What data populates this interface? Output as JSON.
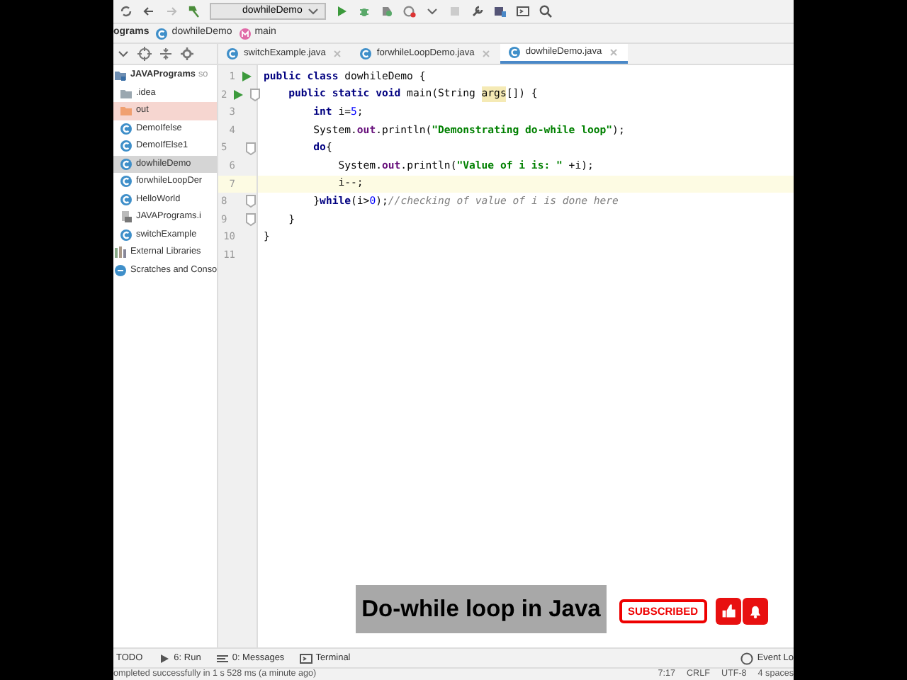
{
  "toolbar": {
    "run_config": "dowhileDemo"
  },
  "breadcrumb": [
    {
      "label": "ograms",
      "kind": "project"
    },
    {
      "label": "dowhileDemo",
      "kind": "class"
    },
    {
      "label": "main",
      "kind": "method"
    }
  ],
  "project_tree": [
    {
      "label": "JAVAPrograms",
      "suffix": "so",
      "kind": "module",
      "selected": false,
      "children": [
        {
          "label": ".idea",
          "kind": "folder",
          "selected": false
        },
        {
          "label": "out",
          "kind": "excluded",
          "selected": false
        },
        {
          "label": "DemoIfelse",
          "kind": "class",
          "selected": false
        },
        {
          "label": "DemoIfElse1",
          "kind": "class",
          "selected": false
        },
        {
          "label": "dowhileDemo",
          "kind": "class",
          "selected": true
        },
        {
          "label": "forwhileLoopDer",
          "kind": "class",
          "selected": false
        },
        {
          "label": "HelloWorld",
          "kind": "class",
          "selected": false
        },
        {
          "label": "JAVAPrograms.i",
          "kind": "file",
          "selected": false
        },
        {
          "label": "switchExample",
          "kind": "class",
          "selected": false
        }
      ]
    },
    {
      "label": "External Libraries",
      "kind": "library",
      "selected": false
    },
    {
      "label": "Scratches and Conso",
      "kind": "scratch",
      "selected": false
    }
  ],
  "editor_tabs": [
    {
      "label": "switchExample.java",
      "selected": false
    },
    {
      "label": "forwhileLoopDemo.java",
      "selected": false
    },
    {
      "label": "dowhileDemo.java",
      "selected": true
    }
  ],
  "code_lines": [
    {
      "number": "1",
      "run": true,
      "fold": false,
      "current": false,
      "tokens": [
        {
          "kind": "kw",
          "text": "public class "
        },
        {
          "kind": "plain",
          "text": "dowhileDemo {"
        }
      ]
    },
    {
      "number": "2",
      "run": true,
      "fold": true,
      "current": false,
      "tokens": [
        {
          "kind": "kw",
          "text": "    public static void "
        },
        {
          "kind": "plain",
          "text": "main(String "
        },
        {
          "kind": "param",
          "text": "args"
        },
        {
          "kind": "plain",
          "text": "[]) {"
        }
      ]
    },
    {
      "number": "3",
      "run": false,
      "fold": false,
      "current": false,
      "tokens": [
        {
          "kind": "kw",
          "text": "        int "
        },
        {
          "kind": "plain",
          "text": "i="
        },
        {
          "kind": "num",
          "text": "5"
        },
        {
          "kind": "plain",
          "text": ";"
        }
      ]
    },
    {
      "number": "4",
      "run": false,
      "fold": false,
      "current": false,
      "tokens": [
        {
          "kind": "plain",
          "text": "        System."
        },
        {
          "kind": "field",
          "text": "out"
        },
        {
          "kind": "plain",
          "text": ".println("
        },
        {
          "kind": "str",
          "text": "\"Demonstrating do-while loop\""
        },
        {
          "kind": "plain",
          "text": ");"
        }
      ]
    },
    {
      "number": "5",
      "run": false,
      "fold": true,
      "current": false,
      "tokens": [
        {
          "kind": "kw",
          "text": "        do"
        },
        {
          "kind": "plain",
          "text": "{"
        }
      ]
    },
    {
      "number": "6",
      "run": false,
      "fold": false,
      "current": false,
      "tokens": [
        {
          "kind": "plain",
          "text": "            System."
        },
        {
          "kind": "field",
          "text": "out"
        },
        {
          "kind": "plain",
          "text": ".println("
        },
        {
          "kind": "str",
          "text": "\"Value of i is: \""
        },
        {
          "kind": "plain",
          "text": " +i);"
        }
      ]
    },
    {
      "number": "7",
      "run": false,
      "fold": false,
      "current": true,
      "tokens": [
        {
          "kind": "plain",
          "text": "            i--;"
        }
      ]
    },
    {
      "number": "8",
      "run": false,
      "fold": true,
      "current": false,
      "tokens": [
        {
          "kind": "plain",
          "text": "        }"
        },
        {
          "kind": "kw",
          "text": "while"
        },
        {
          "kind": "plain",
          "text": "(i>"
        },
        {
          "kind": "num",
          "text": "0"
        },
        {
          "kind": "plain",
          "text": ");"
        },
        {
          "kind": "comment",
          "text": "//checking of value of i is done here"
        }
      ]
    },
    {
      "number": "9",
      "run": false,
      "fold": true,
      "current": false,
      "tokens": [
        {
          "kind": "plain",
          "text": "    }"
        }
      ]
    },
    {
      "number": "10",
      "run": false,
      "fold": false,
      "current": false,
      "tokens": [
        {
          "kind": "plain",
          "text": "}"
        }
      ]
    },
    {
      "number": "11",
      "run": false,
      "fold": false,
      "current": false
    }
  ],
  "caption": {
    "title": "Do-while loop in Java",
    "button": "SUBSCRIBED"
  },
  "tool_tabs": [
    {
      "label": "TODO",
      "kind": "todo"
    },
    {
      "label": "6: Run",
      "kind": "run"
    },
    {
      "label": "0: Messages",
      "kind": "messages"
    },
    {
      "label": "Terminal",
      "kind": "terminal"
    }
  ],
  "event_log": "Event Lo",
  "status_bar": {
    "message": "ompleted successfully in 1 s 528 ms (a minute ago)",
    "items": [
      "7:17",
      "CRLF",
      "UTF-8",
      "4 spaces"
    ]
  }
}
